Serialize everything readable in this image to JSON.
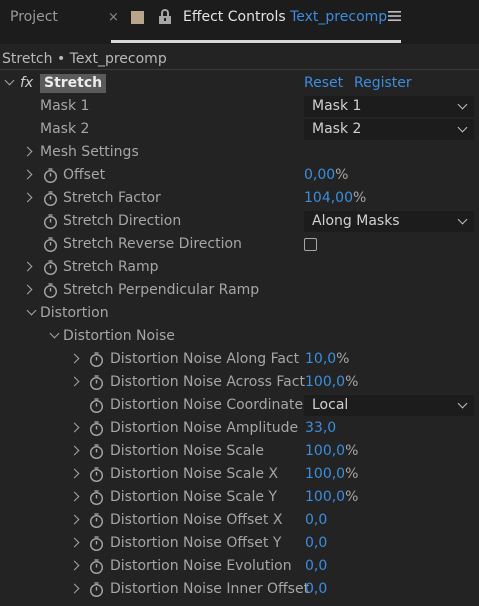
{
  "tabs": {
    "project": "Project",
    "close": "×",
    "title_prefix": "Effect Controls",
    "comp_name": "Text_precomp"
  },
  "breadcrumb": "Stretch • Text_precomp",
  "effect": {
    "fx_label": "fx",
    "name": "Stretch",
    "reset": "Reset",
    "register": "Register"
  },
  "rows": {
    "mask1": {
      "label": "Mask 1",
      "value": "Mask 1"
    },
    "mask2": {
      "label": "Mask 2",
      "value": "Mask 2"
    },
    "mesh": {
      "label": "Mesh Settings"
    },
    "offset": {
      "label": "Offset",
      "value": "0,00",
      "unit": "%"
    },
    "stretch_factor": {
      "label": "Stretch Factor",
      "value": "104,00",
      "unit": "%"
    },
    "stretch_direction": {
      "label": "Stretch Direction",
      "value": "Along Masks"
    },
    "stretch_reverse": {
      "label": "Stretch Reverse Direction",
      "checked": false
    },
    "stretch_ramp": {
      "label": "Stretch Ramp"
    },
    "stretch_perp_ramp": {
      "label": "Stretch Perpendicular Ramp"
    },
    "distortion": {
      "label": "Distortion"
    },
    "distortion_noise": {
      "label": "Distortion Noise"
    },
    "dn_along": {
      "label": "Distortion Noise Along Fact",
      "value": "10,0",
      "unit": "%"
    },
    "dn_across": {
      "label": "Distortion Noise Across Fact",
      "value": "100,0",
      "unit": "%"
    },
    "dn_coordinate": {
      "label": "Distortion Noise Coordinate",
      "value": "Local"
    },
    "dn_amplitude": {
      "label": "Distortion Noise Amplitude",
      "value": "33,0"
    },
    "dn_scale": {
      "label": "Distortion Noise Scale",
      "value": "100,0",
      "unit": "%"
    },
    "dn_scale_x": {
      "label": "Distortion Noise Scale X",
      "value": "100,0",
      "unit": "%"
    },
    "dn_scale_y": {
      "label": "Distortion Noise Scale Y",
      "value": "100,0",
      "unit": "%"
    },
    "dn_offset_x": {
      "label": "Distortion Noise Offset X",
      "value": "0,0"
    },
    "dn_offset_y": {
      "label": "Distortion Noise Offset Y",
      "value": "0,0"
    },
    "dn_evolution": {
      "label": "Distortion Noise Evolution",
      "value": "0,0"
    },
    "dn_inner_offset": {
      "label": "Distortion Noise Inner Offset",
      "value": "0,0"
    }
  },
  "colors": {
    "background": "#232323",
    "value_blue": "#3b8ede",
    "label_gray": "#a6a6a6"
  },
  "icons": {
    "stopwatch": "stopwatch-icon",
    "chevron": "chevron-icon",
    "lock": "lock-icon",
    "menu": "hamburger-menu-icon"
  }
}
